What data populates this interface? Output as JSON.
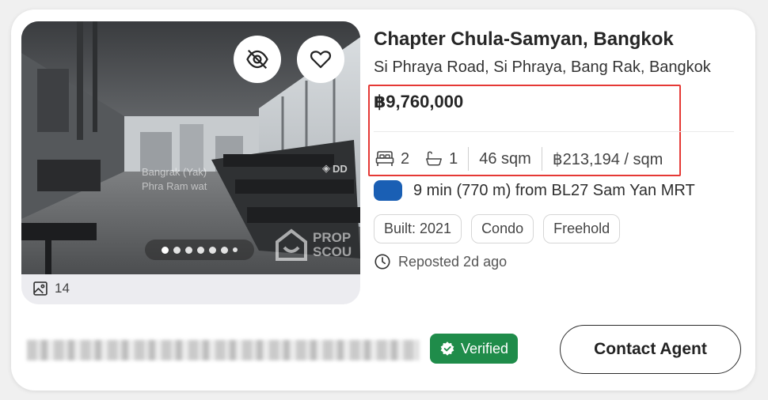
{
  "listing": {
    "title": "Chapter Chula-Samyan, Bangkok",
    "address": "Si Phraya Road, Si Phraya, Bang Rak, Bangkok",
    "price": "฿9,760,000",
    "bedrooms": "2",
    "bathrooms": "1",
    "area": "46 sqm",
    "price_per_sqm": "฿213,194 / sqm",
    "transit": {
      "badge_color": "#1a5fb4",
      "text": "9 min (770 m) from BL27 Sam Yan MRT"
    },
    "tags": [
      "Built: 2021",
      "Condo",
      "Freehold"
    ],
    "reposted": "Reposted 2d ago"
  },
  "photo": {
    "count": "14",
    "overlay_place_line1": "Bangrak (Yak)",
    "overlay_place_line2": "Phra Ram wat",
    "watermark": "PROPERTY SCOUT",
    "watermark_line1": "PROP",
    "watermark_line2": "SCOU",
    "dd_mark": "DD",
    "carousel_dots": 7,
    "active_dot": 0
  },
  "icons": {
    "hide": "eye-off-icon",
    "favorite": "heart-icon",
    "gallery": "image-icon",
    "bed": "bed-icon",
    "bath": "bathtub-icon",
    "clock": "clock-icon",
    "verified": "verified-badge-icon"
  },
  "agent": {
    "verified_label": "Verified",
    "contact_label": "Contact Agent"
  },
  "colors": {
    "verified_bg": "#1f8c4a",
    "highlight_border": "#e53935",
    "text_primary": "#262626"
  }
}
